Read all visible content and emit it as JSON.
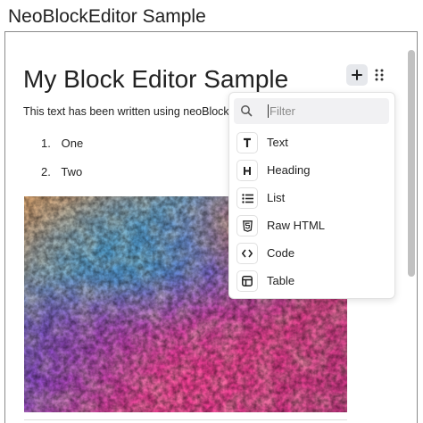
{
  "app": {
    "title": "NeoBlockEditor Sample"
  },
  "document": {
    "heading": "My Block Editor Sample",
    "paragraph": "This text has been written using neoBlock",
    "list": [
      {
        "number": "1.",
        "text": "One"
      },
      {
        "number": "2.",
        "text": "Two"
      }
    ]
  },
  "toolbar": {
    "add_icon": "plus-icon",
    "drag_icon": "drag-handle-icon"
  },
  "menu": {
    "filter_placeholder": "Filter",
    "items": [
      {
        "icon": "T",
        "icon_name": "text-icon",
        "label": "Text"
      },
      {
        "icon": "H",
        "icon_name": "heading-icon",
        "label": "Heading"
      },
      {
        "icon": "list",
        "icon_name": "list-icon",
        "label": "List"
      },
      {
        "icon": "html5",
        "icon_name": "html-icon",
        "label": "Raw HTML"
      },
      {
        "icon": "<>",
        "icon_name": "code-icon",
        "label": "Code"
      },
      {
        "icon": "table",
        "icon_name": "table-icon",
        "label": "Table"
      }
    ]
  }
}
